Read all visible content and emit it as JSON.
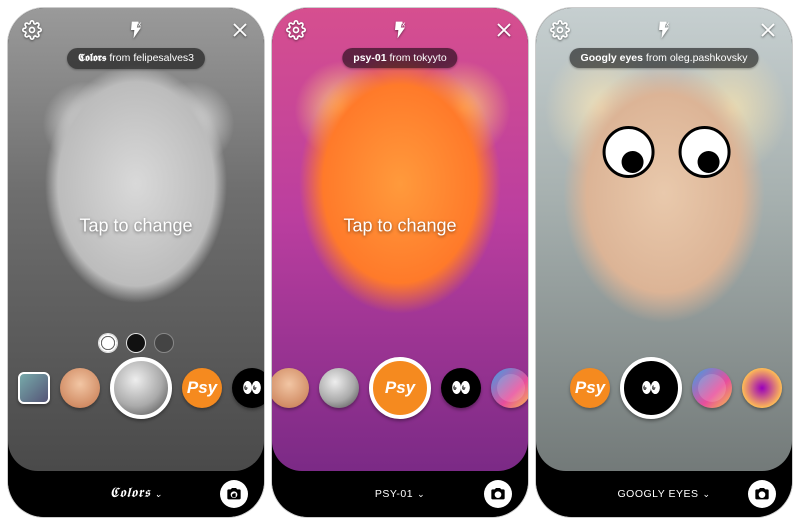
{
  "screens": [
    {
      "filter_name": "𝕮𝖔𝖑𝖔𝖗𝖘",
      "filter_author": "felipesalves3",
      "from_word": "from",
      "tap_hint": "Tap to change",
      "bottom_label": "𝕮𝖔𝖑𝖔𝖗𝖘"
    },
    {
      "filter_name": "psy-01",
      "filter_author": "tokyyto",
      "from_word": "from",
      "tap_hint": "Tap to change",
      "bottom_label": "PSY-01"
    },
    {
      "filter_name": "Googly eyes",
      "filter_author": "oleg.pashkovsky",
      "from_word": "from",
      "tap_hint": "",
      "bottom_label": "GOOGLY EYES"
    }
  ]
}
